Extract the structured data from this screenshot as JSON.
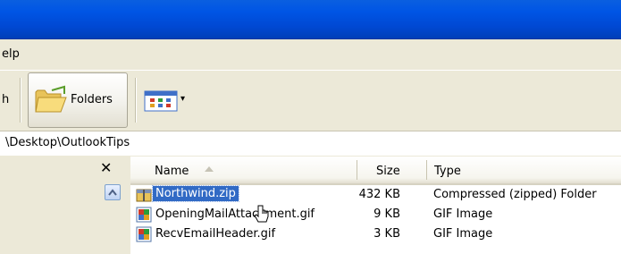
{
  "menubar": {
    "partial_item": "elp"
  },
  "toolbar": {
    "partial_item": "h",
    "folders_label": "Folders",
    "views_arrow": "▾"
  },
  "address": {
    "path": "\\Desktop\\OutlookTips"
  },
  "left_pane": {
    "close_glyph": "✕"
  },
  "columns": {
    "name": "Name",
    "size": "Size",
    "type": "Type"
  },
  "files": [
    {
      "name": "Northwind.zip",
      "size": "432 KB",
      "type": "Compressed (zipped) Folder",
      "icon": "zip-folder-icon",
      "selected": true
    },
    {
      "name": "OpeningMailAttachment.gif",
      "size": "9 KB",
      "type": "GIF Image",
      "icon": "gif-image-icon",
      "selected": false
    },
    {
      "name": "RecvEmailHeader.gif",
      "size": "3 KB",
      "type": "GIF Image",
      "icon": "gif-image-icon",
      "selected": false
    }
  ],
  "colors": {
    "title_blue": "#0055e5",
    "selection": "#316ac5",
    "chrome": "#ece9d8"
  }
}
